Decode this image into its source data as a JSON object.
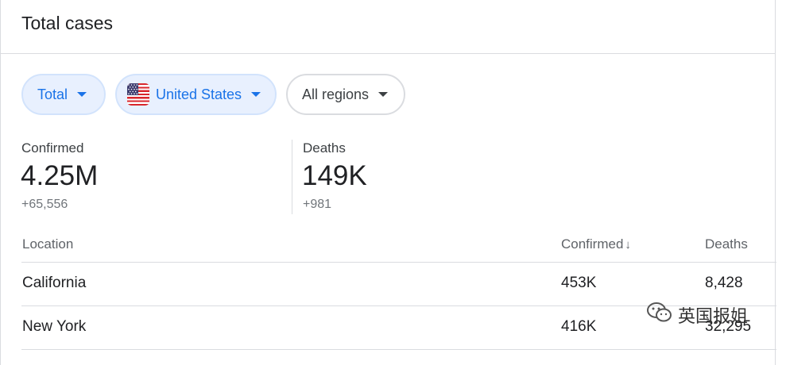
{
  "card": {
    "title": "Total cases"
  },
  "filters": {
    "scope": "Total",
    "country": "United States",
    "region": "All regions"
  },
  "stats": {
    "confirmed": {
      "label": "Confirmed",
      "value": "4.25M",
      "delta": "+65,556"
    },
    "deaths": {
      "label": "Deaths",
      "value": "149K",
      "delta": "+981"
    }
  },
  "table": {
    "headers": {
      "location": "Location",
      "confirmed": "Confirmed",
      "deaths": "Deaths"
    },
    "rows": [
      {
        "location": "California",
        "confirmed": "453K",
        "deaths": "8,428"
      },
      {
        "location": "New York",
        "confirmed": "416K",
        "deaths": "32,295"
      }
    ]
  },
  "watermark": {
    "text": "英国报姐",
    "icon": "wechat-icon"
  },
  "colors": {
    "accent": "#1a73e8",
    "chip_selected_bg": "#e8f0fe",
    "divider": "#dadce0"
  }
}
